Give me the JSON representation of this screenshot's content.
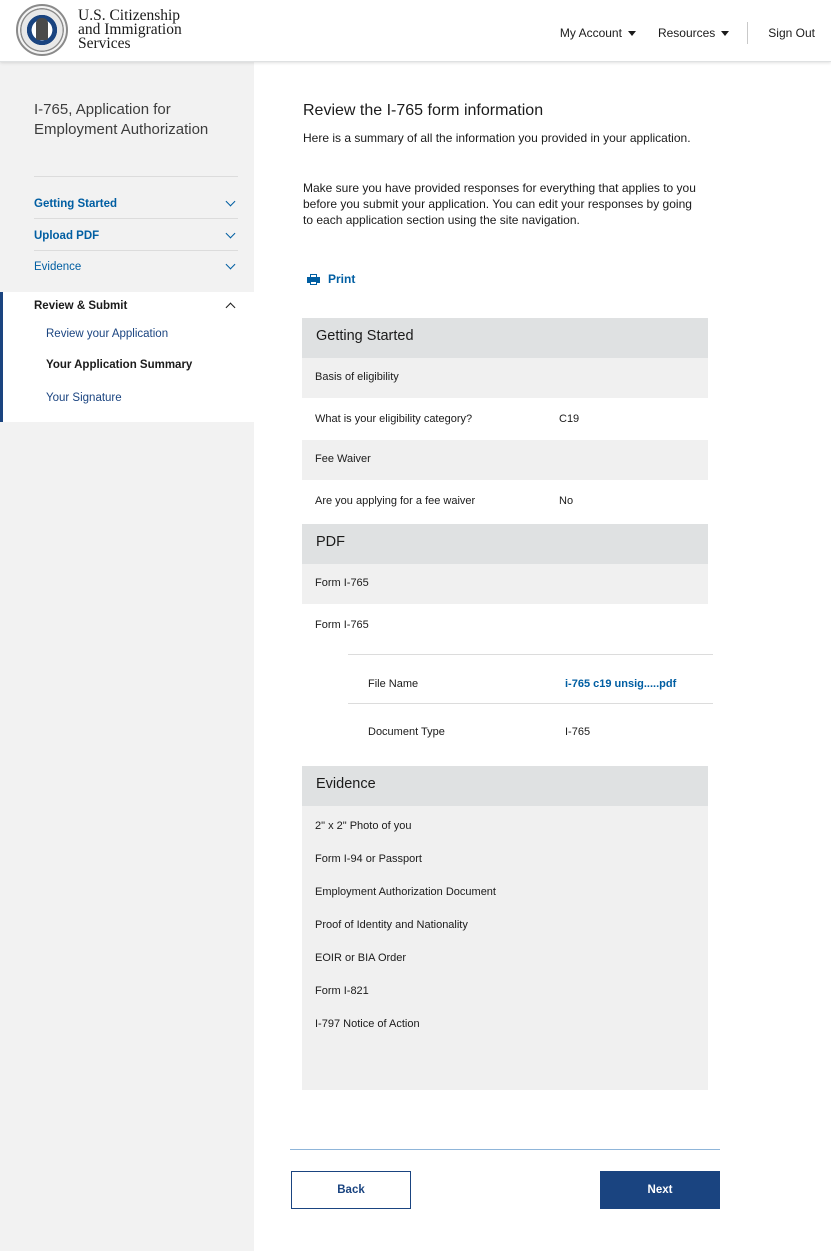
{
  "header": {
    "agency_line1": "U.S. Citizenship",
    "agency_line2": "and Immigration",
    "agency_line3": "Services",
    "nav": {
      "my_account": "My Account",
      "resources": "Resources",
      "sign_out": "Sign Out"
    }
  },
  "sidebar": {
    "form_title": "I-765, Application for Employment Authorization",
    "sections": [
      {
        "label": "Getting Started"
      },
      {
        "label": "Upload PDF"
      },
      {
        "label": "Evidence"
      }
    ],
    "active_section": {
      "label": "Review & Submit",
      "items": [
        {
          "label": "Review your Application"
        },
        {
          "label": "Your Application Summary"
        },
        {
          "label": "Your Signature"
        }
      ]
    }
  },
  "main": {
    "title": "Review the I-765 form information",
    "intro1": "Here is a summary of all the information you provided in your application.",
    "intro2": "Make sure you have provided responses for everything that applies to you before you submit your application. You can edit your responses by going to each application section using the site navigation.",
    "print_label": "Print",
    "getting_started": {
      "heading": "Getting Started",
      "basis_label": "Basis of eligibility",
      "category_q": "What is your eligibility category?",
      "category_a": "C19",
      "fee_label": "Fee Waiver",
      "fee_q": "Are you applying for a fee waiver",
      "fee_a": "No"
    },
    "pdf": {
      "heading": "PDF",
      "form_label_1": "Form I-765",
      "form_label_2": "Form I-765",
      "file_name_label": "File Name",
      "file_name_value": "i-765 c19 unsig.....pdf",
      "doc_type_label": "Document Type",
      "doc_type_value": "I-765"
    },
    "evidence": {
      "heading": "Evidence",
      "items": [
        "2\" x 2\" Photo of you",
        "Form I-94 or Passport",
        "Employment Authorization Document",
        "Proof of Identity and Nationality",
        "EOIR or BIA Order",
        "Form I-821",
        "I-797 Notice of Action"
      ]
    },
    "back_label": "Back",
    "next_label": "Next"
  },
  "colors": {
    "primary": "#1a4480",
    "link": "#005ea2",
    "band": "#dfe1e2",
    "row_shade": "#f0f0f0",
    "sidebar_bg": "#f2f2f2"
  },
  "icons": [
    "seal-logo",
    "chevron-down-icon",
    "chevron-up-icon",
    "printer-icon",
    "caret-down-icon"
  ]
}
